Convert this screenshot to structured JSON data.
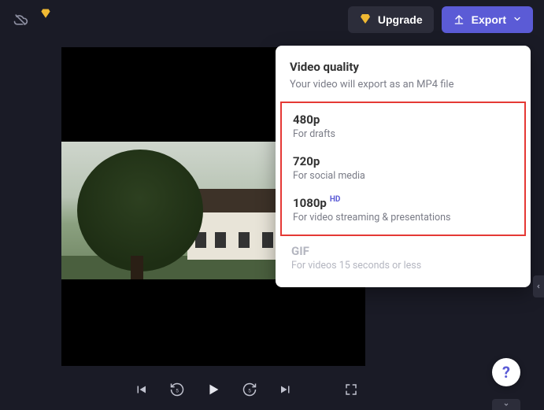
{
  "topbar": {
    "upgrade_label": "Upgrade",
    "export_label": "Export"
  },
  "popover": {
    "title": "Video quality",
    "subtitle": "Your video will export as an MP4 file",
    "options": [
      {
        "label": "480p",
        "desc": "For drafts",
        "badge": ""
      },
      {
        "label": "720p",
        "desc": "For social media",
        "badge": ""
      },
      {
        "label": "1080p",
        "desc": "For video streaming & presentations",
        "badge": "HD"
      }
    ],
    "disabled_option": {
      "label": "GIF",
      "desc": "For videos 15 seconds or less"
    }
  },
  "help": {
    "glyph": "?"
  },
  "icons": {
    "cloud_off": "cloud-off",
    "diamond": "diamond"
  }
}
